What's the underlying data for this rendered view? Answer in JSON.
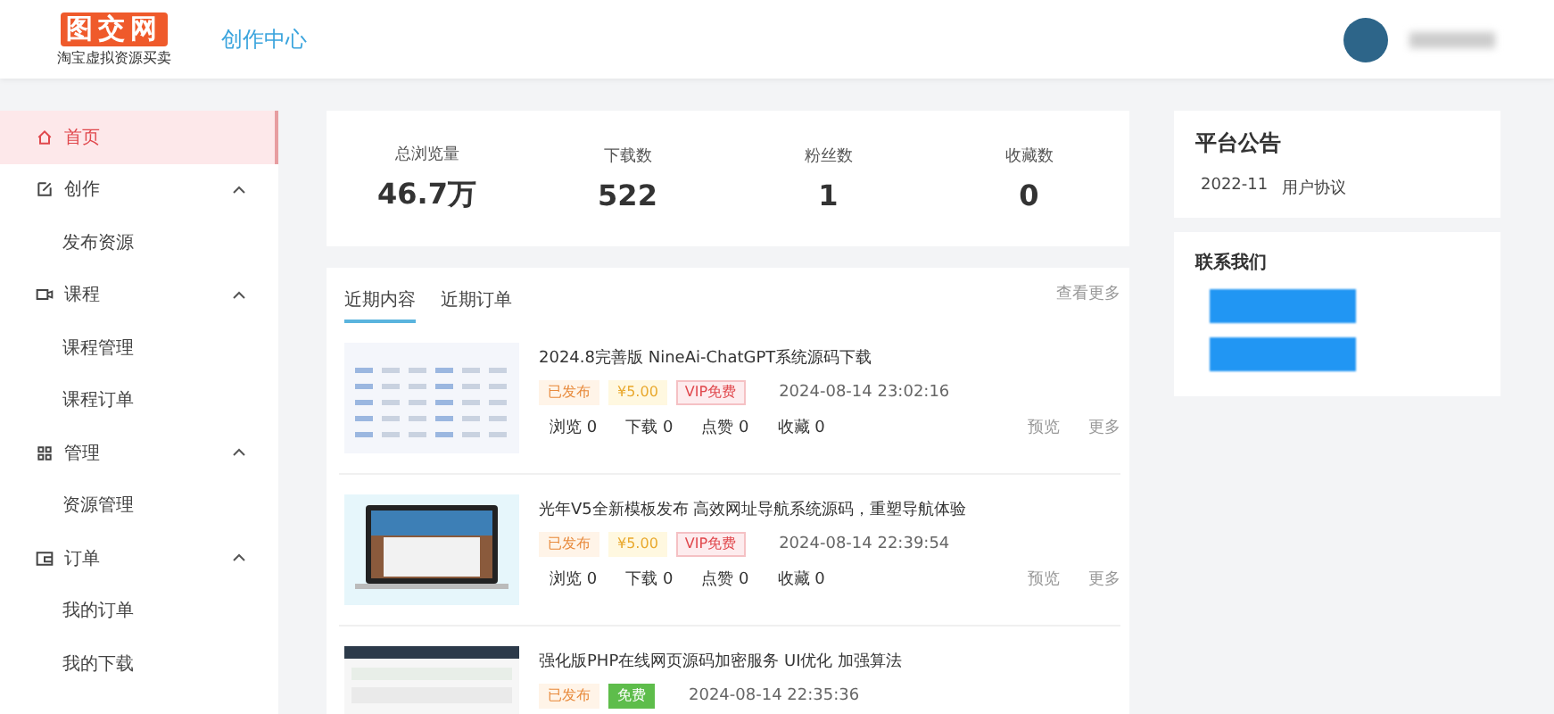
{
  "header": {
    "logo": "图交网",
    "logo_tagline": "淘宝虚拟资源买卖",
    "section_title": "创作中心"
  },
  "sidebar": {
    "items": [
      {
        "label": "首页",
        "selected": true,
        "expanded": false
      },
      {
        "label": "创作",
        "selected": false,
        "expanded": true,
        "children": [
          {
            "label": "发布资源",
            "selected": false
          }
        ]
      },
      {
        "label": "课程",
        "selected": false,
        "expanded": true,
        "children": [
          {
            "label": "课程管理",
            "selected": false
          },
          {
            "label": "课程订单",
            "selected": false
          }
        ]
      },
      {
        "label": "管理",
        "selected": false,
        "expanded": true,
        "children": [
          {
            "label": "资源管理",
            "selected": false
          }
        ]
      },
      {
        "label": "订单",
        "selected": false,
        "expanded": true,
        "children": [
          {
            "label": "我的订单",
            "selected": false
          },
          {
            "label": "我的下载",
            "selected": false
          }
        ]
      }
    ]
  },
  "stats": [
    {
      "label": "总浏览量",
      "value": "46.7万"
    },
    {
      "label": "下载数",
      "value": "522"
    },
    {
      "label": "粉丝数",
      "value": "1"
    },
    {
      "label": "收藏数",
      "value": "0"
    }
  ],
  "recent": {
    "tabs": [
      {
        "label": "近期内容",
        "selected": true
      },
      {
        "label": "近期订单",
        "selected": false
      }
    ],
    "more_link": "查看更多",
    "items": [
      {
        "title": "2024.8完善版 NineAi-ChatGPT系统源码下载",
        "tags": [
          {
            "kind": "status",
            "text": "已发布"
          },
          {
            "kind": "price",
            "text": "¥5.00"
          },
          {
            "kind": "vip",
            "text": "VIP免费"
          }
        ],
        "date": "2024-08-14 23:02:16",
        "counts": [
          "浏览 0",
          "下载 0",
          "点赞 0",
          "收藏 0"
        ],
        "actions": [
          "预览",
          "更多"
        ]
      },
      {
        "title": "光年V5全新模板发布 高效网址导航系统源码，重塑导航体验",
        "tags": [
          {
            "kind": "status",
            "text": "已发布"
          },
          {
            "kind": "price",
            "text": "¥5.00"
          },
          {
            "kind": "vip",
            "text": "VIP免费"
          }
        ],
        "date": "2024-08-14 22:39:54",
        "counts": [
          "浏览 0",
          "下载 0",
          "点赞 0",
          "收藏 0"
        ],
        "actions": [
          "预览",
          "更多"
        ]
      },
      {
        "title": "强化版PHP在线网页源码加密服务 UI优化 加强算法",
        "tags": [
          {
            "kind": "status",
            "text": "已发布"
          },
          {
            "kind": "free",
            "text": "免费"
          }
        ],
        "date": "2024-08-14 22:35:36"
      }
    ]
  },
  "notice": {
    "title": "平台公告",
    "items": [
      {
        "date": "2022-11",
        "text": "用户协议"
      }
    ]
  },
  "contact": {
    "title": "联系我们"
  }
}
